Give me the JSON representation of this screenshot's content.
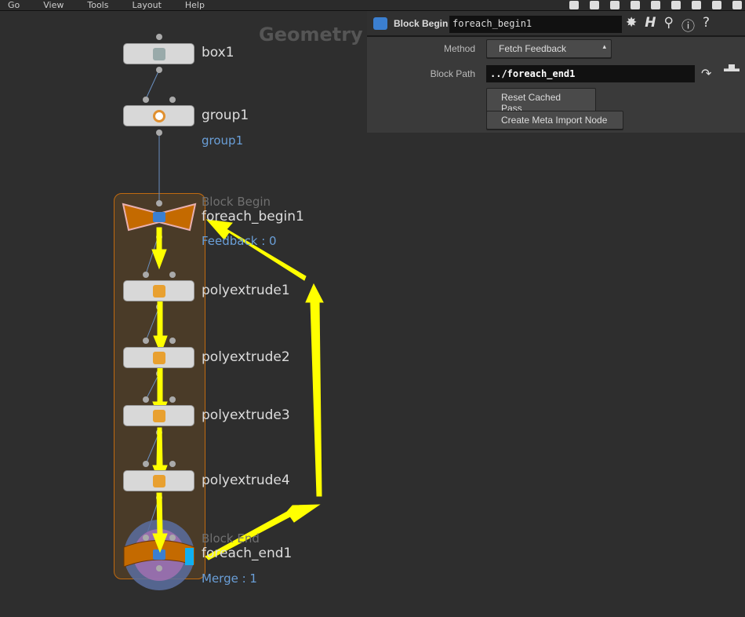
{
  "menu": [
    "Go",
    "View",
    "Tools",
    "Layout",
    "Help"
  ],
  "network": {
    "context_title": "Geometry",
    "nodes": [
      {
        "name": "box1",
        "icon": "box-icon"
      },
      {
        "name": "group1",
        "sub": "group1",
        "icon": "group-icon"
      },
      {
        "name": "foreach_begin1",
        "type": "Block Begin",
        "sub": "Feedback : 0",
        "icon": "block-begin-icon"
      },
      {
        "name": "polyextrude1",
        "icon": "polyextrude-icon"
      },
      {
        "name": "polyextrude2",
        "icon": "polyextrude-icon"
      },
      {
        "name": "polyextrude3",
        "icon": "polyextrude-icon"
      },
      {
        "name": "polyextrude4",
        "icon": "polyextrude-icon"
      },
      {
        "name": "foreach_end1",
        "type": "Block End",
        "sub": "Merge : 1",
        "icon": "block-end-icon"
      }
    ]
  },
  "params": {
    "node_type": "Block Begin",
    "node_name": "foreach_begin1",
    "method_label": "Method",
    "method_value": "Fetch Feedback",
    "block_path_label": "Block Path",
    "block_path_value": "../foreach_end1",
    "reset_button": "Reset Cached Pass",
    "meta_button": "Create Meta Import Node"
  },
  "colors": {
    "annotation_arrow": "#ffff00",
    "block_frame": "#c06a10",
    "link_text": "#6a9fd8"
  }
}
